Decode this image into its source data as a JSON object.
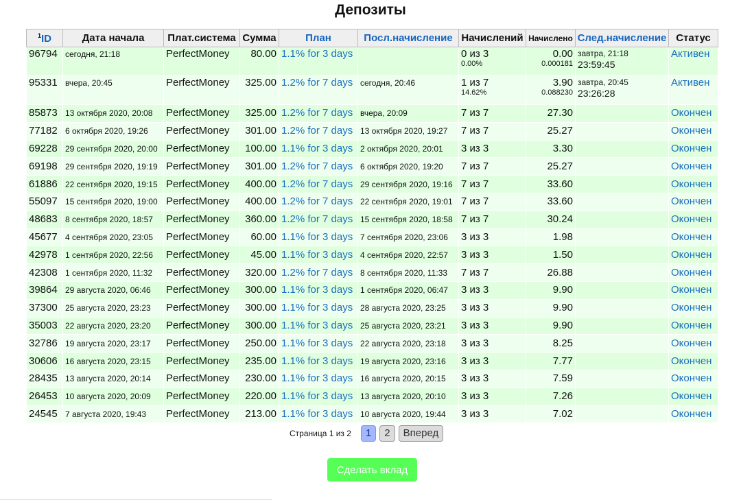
{
  "page": {
    "title": "Депозиты"
  },
  "table": {
    "headers": {
      "id_sup": "1",
      "id": "ID",
      "start_date": "Дата начала",
      "pay_system": "Плат.система",
      "amount": "Сумма",
      "plan": "План",
      "last_accrual": "Посл.начисление",
      "accruals": "Начислений",
      "accrued": "Начислено",
      "next_accrual": "След.начисление",
      "status": "Статус"
    },
    "active_rows": [
      {
        "id": "96794",
        "start": "сегодня, 21:18",
        "system": "PerfectMoney",
        "amount": "80.00",
        "plan": "1.1% for 3 days",
        "last": "",
        "accruals": "0 из 3",
        "accruals_pct": "0.00%",
        "accrued": "0.00",
        "accrued_sub": "0.000181",
        "next": "завтра, 21:18",
        "next_timer": "23:59:45",
        "status": "Активен"
      },
      {
        "id": "95331",
        "start": "вчера, 20:45",
        "system": "PerfectMoney",
        "amount": "325.00",
        "plan": "1.2% for 7 days",
        "last": "сегодня, 20:46",
        "accruals": "1 из 7",
        "accruals_pct": "14.62%",
        "accrued": "3.90",
        "accrued_sub": "0.088230",
        "next": "завтра, 20:45",
        "next_timer": "23:26:28",
        "status": "Активен"
      }
    ],
    "rows": [
      {
        "id": "85873",
        "start": "13 октября 2020, 20:08",
        "system": "PerfectMoney",
        "amount": "325.00",
        "plan": "1.2% for 7 days",
        "last": "вчера, 20:09",
        "accruals": "7 из 7",
        "accrued": "27.30",
        "next": "",
        "status": "Окончен"
      },
      {
        "id": "77182",
        "start": "6 октября 2020, 19:26",
        "system": "PerfectMoney",
        "amount": "301.00",
        "plan": "1.2% for 7 days",
        "last": "13 октября 2020, 19:27",
        "accruals": "7 из 7",
        "accrued": "25.27",
        "next": "",
        "status": "Окончен"
      },
      {
        "id": "69228",
        "start": "29 сентября 2020, 20:00",
        "system": "PerfectMoney",
        "amount": "100.00",
        "plan": "1.1% for 3 days",
        "last": "2 октября 2020, 20:01",
        "accruals": "3 из 3",
        "accrued": "3.30",
        "next": "",
        "status": "Окончен"
      },
      {
        "id": "69198",
        "start": "29 сентября 2020, 19:19",
        "system": "PerfectMoney",
        "amount": "301.00",
        "plan": "1.2% for 7 days",
        "last": "6 октября 2020, 19:20",
        "accruals": "7 из 7",
        "accrued": "25.27",
        "next": "",
        "status": "Окончен"
      },
      {
        "id": "61886",
        "start": "22 сентября 2020, 19:15",
        "system": "PerfectMoney",
        "amount": "400.00",
        "plan": "1.2% for 7 days",
        "last": "29 сентября 2020, 19:16",
        "accruals": "7 из 7",
        "accrued": "33.60",
        "next": "",
        "status": "Окончен"
      },
      {
        "id": "55097",
        "start": "15 сентября 2020, 19:00",
        "system": "PerfectMoney",
        "amount": "400.00",
        "plan": "1.2% for 7 days",
        "last": "22 сентября 2020, 19:01",
        "accruals": "7 из 7",
        "accrued": "33.60",
        "next": "",
        "status": "Окончен"
      },
      {
        "id": "48683",
        "start": "8 сентября 2020, 18:57",
        "system": "PerfectMoney",
        "amount": "360.00",
        "plan": "1.2% for 7 days",
        "last": "15 сентября 2020, 18:58",
        "accruals": "7 из 7",
        "accrued": "30.24",
        "next": "",
        "status": "Окончен"
      },
      {
        "id": "45677",
        "start": "4 сентября 2020, 23:05",
        "system": "PerfectMoney",
        "amount": "60.00",
        "plan": "1.1% for 3 days",
        "last": "7 сентября 2020, 23:06",
        "accruals": "3 из 3",
        "accrued": "1.98",
        "next": "",
        "status": "Окончен"
      },
      {
        "id": "42978",
        "start": "1 сентября 2020, 22:56",
        "system": "PerfectMoney",
        "amount": "45.00",
        "plan": "1.1% for 3 days",
        "last": "4 сентября 2020, 22:57",
        "accruals": "3 из 3",
        "accrued": "1.50",
        "next": "",
        "status": "Окончен"
      },
      {
        "id": "42308",
        "start": "1 сентября 2020, 11:32",
        "system": "PerfectMoney",
        "amount": "320.00",
        "plan": "1.2% for 7 days",
        "last": "8 сентября 2020, 11:33",
        "accruals": "7 из 7",
        "accrued": "26.88",
        "next": "",
        "status": "Окончен"
      },
      {
        "id": "39864",
        "start": "29 августа 2020, 06:46",
        "system": "PerfectMoney",
        "amount": "300.00",
        "plan": "1.1% for 3 days",
        "last": "1 сентября 2020, 06:47",
        "accruals": "3 из 3",
        "accrued": "9.90",
        "next": "",
        "status": "Окончен"
      },
      {
        "id": "37300",
        "start": "25 августа 2020, 23:23",
        "system": "PerfectMoney",
        "amount": "300.00",
        "plan": "1.1% for 3 days",
        "last": "28 августа 2020, 23:25",
        "accruals": "3 из 3",
        "accrued": "9.90",
        "next": "",
        "status": "Окончен"
      },
      {
        "id": "35003",
        "start": "22 августа 2020, 23:20",
        "system": "PerfectMoney",
        "amount": "300.00",
        "plan": "1.1% for 3 days",
        "last": "25 августа 2020, 23:21",
        "accruals": "3 из 3",
        "accrued": "9.90",
        "next": "",
        "status": "Окончен"
      },
      {
        "id": "32786",
        "start": "19 августа 2020, 23:17",
        "system": "PerfectMoney",
        "amount": "250.00",
        "plan": "1.1% for 3 days",
        "last": "22 августа 2020, 23:18",
        "accruals": "3 из 3",
        "accrued": "8.25",
        "next": "",
        "status": "Окончен"
      },
      {
        "id": "30606",
        "start": "16 августа 2020, 23:15",
        "system": "PerfectMoney",
        "amount": "235.00",
        "plan": "1.1% for 3 days",
        "last": "19 августа 2020, 23:16",
        "accruals": "3 из 3",
        "accrued": "7.77",
        "next": "",
        "status": "Окончен"
      },
      {
        "id": "28435",
        "start": "13 августа 2020, 20:14",
        "system": "PerfectMoney",
        "amount": "230.00",
        "plan": "1.1% for 3 days",
        "last": "16 августа 2020, 20:15",
        "accruals": "3 из 3",
        "accrued": "7.59",
        "next": "",
        "status": "Окончен"
      },
      {
        "id": "26453",
        "start": "10 августа 2020, 20:09",
        "system": "PerfectMoney",
        "amount": "220.00",
        "plan": "1.1% for 3 days",
        "last": "13 августа 2020, 20:10",
        "accruals": "3 из 3",
        "accrued": "7.26",
        "next": "",
        "status": "Окончен"
      },
      {
        "id": "24545",
        "start": "7 августа 2020, 19:43",
        "system": "PerfectMoney",
        "amount": "213.00",
        "plan": "1.1% for 3 days",
        "last": "10 августа 2020, 19:44",
        "accruals": "3 из 3",
        "accrued": "7.02",
        "next": "",
        "status": "Окончен"
      }
    ]
  },
  "pagination": {
    "label": "Страница 1 из 2",
    "pages": [
      "1",
      "2"
    ],
    "current": "1",
    "next_label": "Вперед"
  },
  "actions": {
    "make_deposit": "Сделать вклад"
  },
  "colors": {
    "row_odd": "#dfffdf",
    "row_even": "#efffef",
    "link_blue": "#1a6fbf",
    "header_bg": "#efefef",
    "button_green": "#55ff55",
    "page_active": "#a4b8ff"
  }
}
